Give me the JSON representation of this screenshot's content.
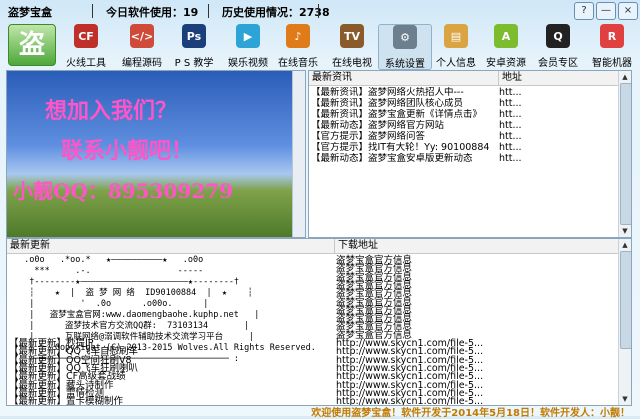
{
  "window": {
    "title": "盗梦宝盒",
    "today_usage": "今日软件使用：19",
    "history_usage": "历史使用情况：2738",
    "controls": [
      "?",
      "—",
      "×"
    ]
  },
  "toolbar": {
    "logo_char": "盗",
    "items": [
      {
        "label": "火线工具",
        "icon": "crossfire-icon",
        "color": "#c0302a",
        "glyph": "CF"
      },
      {
        "label": "编程源码",
        "icon": "code-icon",
        "color": "#d04a3a",
        "glyph": "</>"
      },
      {
        "label": "P S 教学",
        "icon": "photoshop-icon",
        "color": "#1b3f7a",
        "glyph": "Ps"
      },
      {
        "label": "娱乐视频",
        "icon": "video-icon",
        "color": "#2ea3d6",
        "glyph": "▶"
      },
      {
        "label": "在线音乐",
        "icon": "music-icon",
        "color": "#e07b1a",
        "glyph": "♪"
      },
      {
        "label": "在线电视",
        "icon": "tv-icon",
        "color": "#8a5a2a",
        "glyph": "TV"
      },
      {
        "label": "系统设置",
        "icon": "gear-icon",
        "color": "#6c7f8f",
        "glyph": "⚙"
      },
      {
        "label": "个人信息",
        "icon": "folder-icon",
        "color": "#d9a441",
        "glyph": "▤"
      },
      {
        "label": "安卓资源",
        "icon": "android-icon",
        "color": "#7dbb2f",
        "glyph": "A"
      },
      {
        "label": "会员专区",
        "icon": "penguin-icon",
        "color": "#222222",
        "glyph": "Q"
      },
      {
        "label": "智能机器",
        "icon": "robot-icon",
        "color": "#e04040",
        "glyph": "R"
      }
    ]
  },
  "banner": {
    "line1": "想加入我们？",
    "line2": "联系小靓吧！",
    "line3": "小靓QQ：895309279"
  },
  "news": {
    "col_title": "最新资讯",
    "col_url": "地址",
    "rows": [
      {
        "title": "【最新资讯】盗梦网络火热招人中---",
        "url": "htt..."
      },
      {
        "title": "【最新资讯】盗梦网络团队核心成员",
        "url": "htt..."
      },
      {
        "title": "【最新资讯】盗梦宝盒更新《详情点击》",
        "url": "htt..."
      },
      {
        "title": "【最新动态】盗梦网络官方网站",
        "url": "htt..."
      },
      {
        "title": "【官方提示】盗梦网络问答",
        "url": "htt..."
      },
      {
        "title": "【官方提示】找IT有大轮！Yy: 90100884",
        "url": "htt..."
      },
      {
        "title": "【最新动态】盗梦宝盒安卓版更新动态",
        "url": "htt..."
      }
    ]
  },
  "updates": {
    "col_title": "最新更新",
    "col_url": "下载地址",
    "art_lines": [
      " .o0o   .*oo.*   ★——————————★   .o0o",
      "   ***     .-.                 -----",
      "  †--------★—————————————————————★--------†",
      "  ┆    ★  |  盗 梦 网 络  ID90100884  |  ★    ┆",
      "  |         '  .0o      .o00o.      |",
      "  |   盗梦宝盒官网:www.daomengbaohe.kuphp.net   |",
      "  |      盗梦技术官方交流QQ群:  73103134       |",
      "  |      互联网络@溺调软件辅助技术交流学习平台     |",
      "  |    Copyright (C) 2013-2015 Wolves.All Rights Reserved.",
      "  ─────────────────────────────────────── :"
    ],
    "rows": [
      {
        "title": "",
        "url": "盗梦宝盒官方信息"
      },
      {
        "title": "",
        "url": "盗梦宝盒官方信息"
      },
      {
        "title": "",
        "url": "盗梦宝盒官方信息"
      },
      {
        "title": "",
        "url": "盗梦宝盒官方信息"
      },
      {
        "title": "",
        "url": "盗梦宝盒官方信息"
      },
      {
        "title": "",
        "url": "盗梦宝盒官方信息"
      },
      {
        "title": "",
        "url": "盗梦宝盒官方信息"
      },
      {
        "title": "",
        "url": "盗梦宝盒官方信息"
      },
      {
        "title": "",
        "url": "盗梦宝盒官方信息"
      },
      {
        "title": "",
        "url": "盗梦宝盒官方信息"
      },
      {
        "title": "【最新更新】秒提IP",
        "url": "http://www.skycn1.com/file-5..."
      },
      {
        "title": "【最新更新】QQ飞车自慰刷车",
        "url": "http://www.skycn1.com/file-5..."
      },
      {
        "title": "【最新更新】QQ空间狂刷V8",
        "url": "http://www.skycn1.com/file-5..."
      },
      {
        "title": "【最新更新】QQ飞车狂刷喇叭",
        "url": "http://www.skycn1.com/file-5..."
      },
      {
        "title": "【最新更新】CF高级套战绩",
        "url": "http://www.skycn1.com/file-5..."
      },
      {
        "title": "【最新更新】藏头诗制作",
        "url": "http://www.skycn1.com/file-5..."
      },
      {
        "title": "【最新更新】雷情检测",
        "url": "http://www.skycn1.com/file-5..."
      },
      {
        "title": "【最新更新】置卡模糊制作",
        "url": "http://www.skycn1.com/file-5..."
      }
    ]
  },
  "status": {
    "marquee": "欢迎使用盗梦宝盒！软件开发于2014年5月18日！软件开发人：小靓！"
  }
}
